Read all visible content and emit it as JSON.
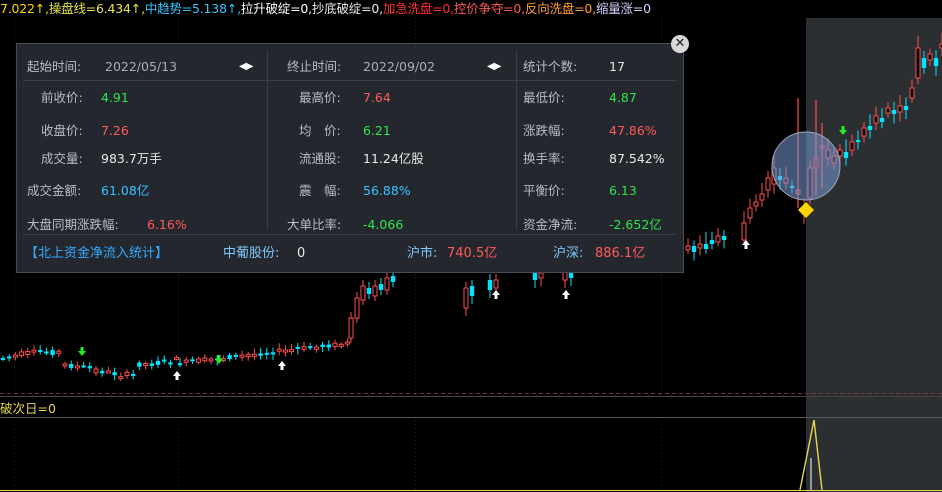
{
  "topbar": [
    {
      "text": "7.022↑,",
      "color": "#ffd800"
    },
    {
      "text": "操盘线=6.434↑,",
      "color": "#e6e648"
    },
    {
      "text": "中趋势=5.138↑,",
      "color": "#35c6ff"
    },
    {
      "text": "拉升破绽=0,",
      "color": "#ffffff"
    },
    {
      "text": "抄底破绽=0,",
      "color": "#e8e8e8"
    },
    {
      "text": "加急洗盘=0,",
      "color": "#ff3030"
    },
    {
      "text": "控价争夺=0,",
      "color": "#ff5a5a"
    },
    {
      "text": "反向洗盘=0,",
      "color": "#ff9c3a"
    },
    {
      "text": "缩量涨=0",
      "color": "#d0d0ff"
    }
  ],
  "subchart_title": "破次日=0",
  "popup": {
    "start_label": "起始时间:",
    "start_value": "2022/05/13",
    "end_label": "终止时间:",
    "end_value": "2022/09/02",
    "count_label": "统计个数:",
    "count_value": "17",
    "rows": [
      {
        "l1": "前收价:",
        "v1": "4.91",
        "c1": "green",
        "l2": "最高价:",
        "v2": "7.64",
        "c2": "red",
        "l3": "最低价:",
        "v3": "4.87",
        "c3": "green"
      },
      {
        "l1": "收盘价:",
        "v1": "7.26",
        "c1": "red",
        "l2": "均　价:",
        "v2": "6.21",
        "c2": "green",
        "l3": "涨跌幅:",
        "v3": "47.86%",
        "c3": "red"
      },
      {
        "l1": "成交量:",
        "v1": "983.7万手",
        "c1": "white",
        "l2": "流通股:",
        "v2": "11.24亿股",
        "c2": "white",
        "l3": "换手率:",
        "v3": "87.542%",
        "c3": "white"
      },
      {
        "l1": "成交金额:",
        "v1": "61.08亿",
        "c1": "cyan",
        "l2": "震　幅:",
        "v2": "56.88%",
        "c2": "cyan",
        "l3": "平衡价:",
        "v3": "6.13",
        "c3": "green"
      },
      {
        "l1": "大盘同期涨跌幅:",
        "v1": "6.16%",
        "c1": "red",
        "l2": "大单比率:",
        "v2": "-4.066",
        "c2": "green",
        "l3": "资金净流:",
        "v3": "-2.652亿",
        "c3": "green"
      }
    ],
    "northbound_link": "【北上资金净流入统计】",
    "stock_label": "中葡股份:",
    "stock_value": "0",
    "sh_label": "沪市:",
    "sh_value": "740.5亿",
    "hs_label": "沪深:",
    "hs_value": "886.1亿"
  },
  "icons": {
    "close": "close-icon",
    "prev": "prev-arrow-icon",
    "next": "next-arrow-icon",
    "warning": "warning-diamond-icon"
  },
  "colors": {
    "up": "#ff4d4d",
    "down": "#00e5ff",
    "highlight_bg": "#2a2d30",
    "circle": "#7a9bd6"
  }
}
